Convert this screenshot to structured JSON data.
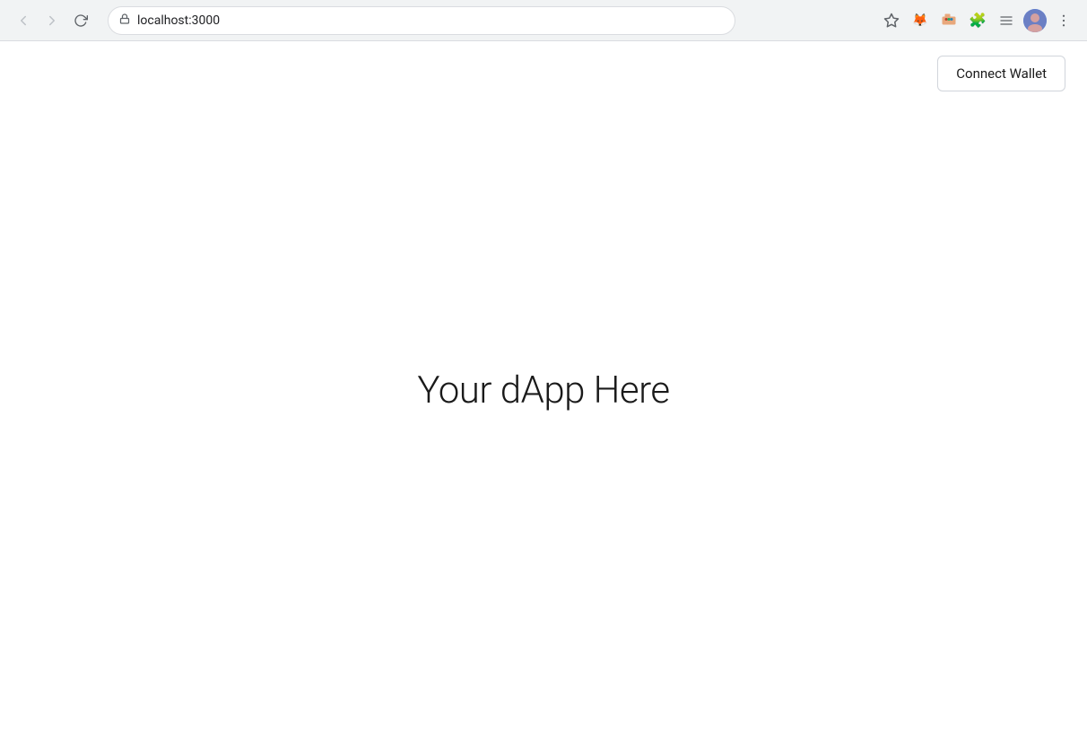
{
  "browser": {
    "url": "localhost:3000",
    "nav": {
      "back_label": "←",
      "forward_label": "→",
      "refresh_label": "↻"
    },
    "extensions": {
      "metamask_icon": "🦊",
      "puzzle_icon": "🧩",
      "menu_icon": "⋮"
    },
    "star_icon": "☆"
  },
  "app": {
    "connect_wallet_label": "Connect Wallet",
    "main_title": "Your dApp Here"
  }
}
